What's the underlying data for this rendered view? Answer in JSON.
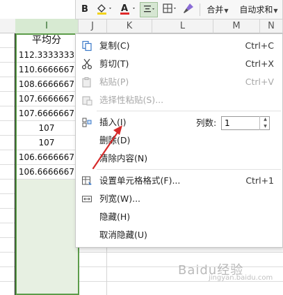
{
  "toolbar": {
    "bold_label": "B",
    "merge_label": "合并",
    "autosum_label": "自动求和"
  },
  "columns": [
    "I",
    "J",
    "K",
    "L",
    "M",
    "N"
  ],
  "column_I": {
    "header": "平均分",
    "values": [
      "112.3333333",
      "110.6666667",
      "108.6666667",
      "107.6666667",
      "107.6666667",
      "107",
      "107",
      "106.6666667",
      "106.6666667"
    ]
  },
  "context_menu": {
    "copy": {
      "label": "复制(C)",
      "shortcut": "Ctrl+C"
    },
    "cut": {
      "label": "剪切(T)",
      "shortcut": "Ctrl+X"
    },
    "paste": {
      "label": "粘贴(P)",
      "shortcut": "Ctrl+V"
    },
    "paste_special": {
      "label": "选择性粘贴(S)..."
    },
    "insert": {
      "label": "插入(I)",
      "count_label": "列数:",
      "count_value": "1"
    },
    "delete": {
      "label": "删除(D)"
    },
    "clear_contents": {
      "label": "清除内容(N)"
    },
    "format_cells": {
      "label": "设置单元格格式(F)...",
      "shortcut": "Ctrl+1"
    },
    "column_width": {
      "label": "列宽(W)..."
    },
    "hide": {
      "label": "隐藏(H)"
    },
    "unhide": {
      "label": "取消隐藏(U)"
    }
  },
  "colors": {
    "selection_green": "#5c9c4a",
    "arrow_red": "#d62a2a"
  },
  "watermark": {
    "main": "Baidu经验",
    "sub": "jingyan.baidu.com"
  }
}
